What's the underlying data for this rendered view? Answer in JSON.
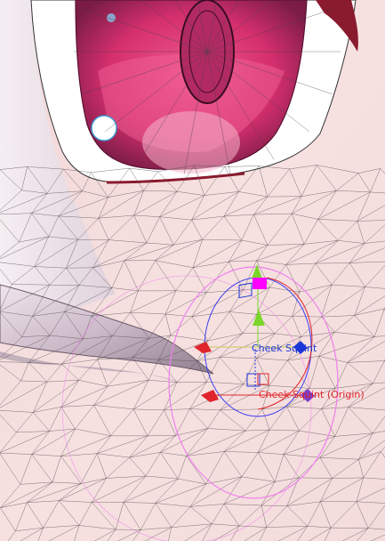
{
  "scene": {
    "labels": {
      "cheek_squint": "Cheek Squint",
      "cheek_squint_origin": "Cheek Squint (Origin)"
    },
    "colors": {
      "skin": "#f4dcdc",
      "wire": "#4a4045",
      "iris_outer": "#a3225c",
      "iris_inner": "#e8417d",
      "pupil": "#7a1c46",
      "hair_lock": "#c9b9c8",
      "cheek_label": "#1a36d8",
      "origin_label": "#e0242b",
      "gizmo_green": "#7ad62a",
      "gizmo_red": "#e0242b",
      "gizmo_blue": "#1a36d8",
      "gizmo_magenta": "#ff00ff",
      "gizmo_purple": "#7a3cc8",
      "ellipse_pink": "#f07ef0"
    }
  }
}
